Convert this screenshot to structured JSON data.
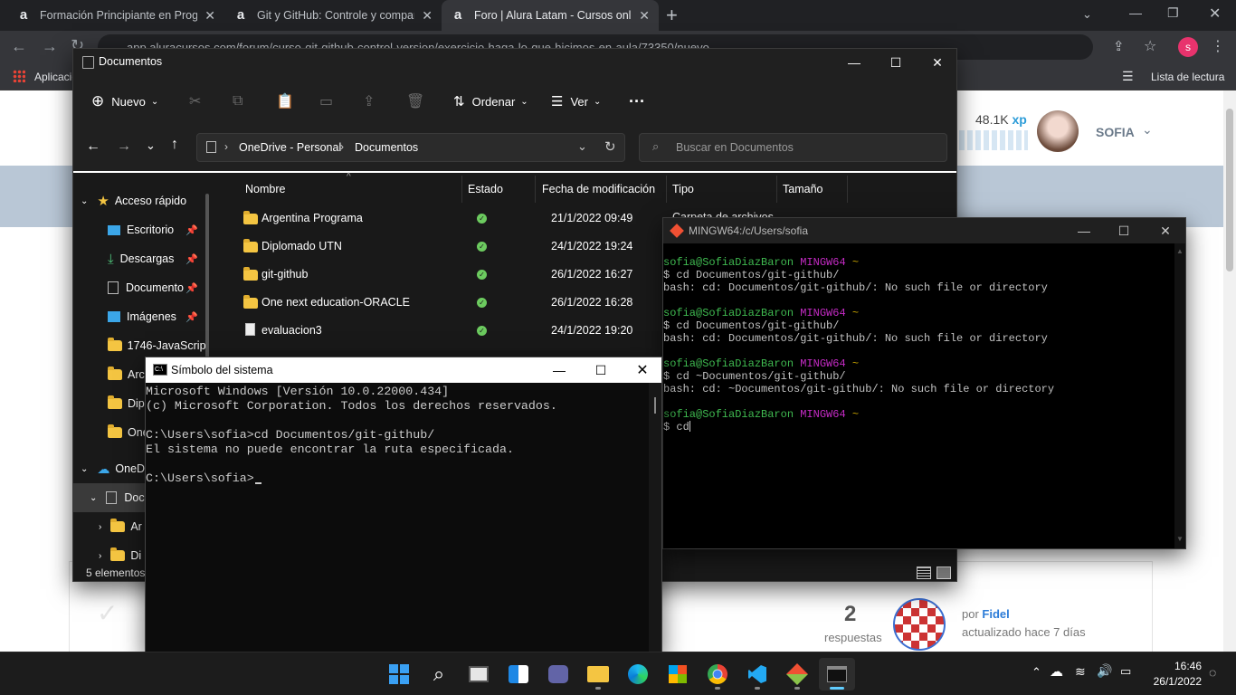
{
  "chrome": {
    "tabs": [
      {
        "favicon": "a",
        "title": "Formación Principiante en Progra"
      },
      {
        "favicon": "a",
        "title": "Git y GitHub: Controle y compart"
      },
      {
        "favicon": "a",
        "title": "Foro | Alura Latam - Cursos onlin"
      }
    ],
    "new_tab": "+",
    "url": "app.aluracursos.com/forum/curso-git-github-control-version/exercicio-haga-lo-que-hicimos-en-aula/73350/nuevo",
    "profile_initial": "s",
    "bookmarks_apps": "Aplicaciones",
    "reading_list": "Lista de lectura"
  },
  "alura_page": {
    "xp": "48.1K",
    "xp_unit": "xp",
    "user_name": "SOFIA",
    "topic_count": "2",
    "topic_count_label": "respuestas",
    "by_label": "por",
    "author": "Fidel",
    "updated": "actualizado hace 7 días"
  },
  "explorer": {
    "title": "Documentos",
    "cmd_new": "Nuevo",
    "cmd_sort": "Ordenar",
    "cmd_view": "Ver",
    "more": "···",
    "breadcrumb": [
      "OneDrive - Personal",
      "Documentos"
    ],
    "search_placeholder": "Buscar en Documentos",
    "columns": {
      "name": "Nombre",
      "status": "Estado",
      "date": "Fecha de modificación",
      "type": "Tipo",
      "size": "Tamaño"
    },
    "files": [
      {
        "name": "Argentina Programa",
        "date": "21/1/2022 09:49",
        "kind": "folder"
      },
      {
        "name": "Diplomado UTN",
        "date": "24/1/2022 19:24",
        "kind": "folder"
      },
      {
        "name": "git-github",
        "date": "26/1/2022 16:27",
        "kind": "folder"
      },
      {
        "name": "One next education-ORACLE",
        "date": "26/1/2022 16:28",
        "kind": "folder"
      },
      {
        "name": "evaluacion3",
        "date": "24/1/2022 19:20",
        "kind": "file"
      }
    ],
    "type_partial": "Carpeta de archivos",
    "nav": {
      "quick_access": "Acceso rápido",
      "items": [
        "Escritorio",
        "Descargas",
        "Documento",
        "Imágenes",
        "1746-JavaScript",
        "Arch",
        "Dipl",
        "One"
      ],
      "onedrive": "OneD",
      "docs": "Doc",
      "sub1": "Ar",
      "sub2": "Di"
    },
    "status_bar": "5 elementos"
  },
  "cmd": {
    "title": "Símbolo del sistema",
    "lines": [
      "Microsoft Windows [Versión 10.0.22000.434]",
      "(c) Microsoft Corporation. Todos los derechos reservados.",
      "",
      "C:\\Users\\sofia>cd Documentos/git-github/",
      "El sistema no puede encontrar la ruta especificada.",
      "",
      "C:\\Users\\sofia>"
    ]
  },
  "mingw": {
    "title": "MINGW64:/c/Users/sofia",
    "user_host": "sofia@SofiaDiazBaron",
    "env": "MINGW64",
    "dir": "~",
    "blocks": [
      {
        "cmd": "$ cd Documentos/git-github/",
        "out": "bash: cd: Documentos/git-github/: No such file or directory"
      },
      {
        "cmd": "$ cd Documentos/git-github/",
        "out": "bash: cd: Documentos/git-github/: No such file or directory"
      },
      {
        "cmd": "$ cd ~Documentos/git-github/",
        "out": "bash: cd: ~Documentos/git-github/: No such file or directory"
      },
      {
        "cmd": "$ cd",
        "out": ""
      }
    ]
  },
  "taskbar": {
    "time": "16:46",
    "date": "26/1/2022"
  }
}
